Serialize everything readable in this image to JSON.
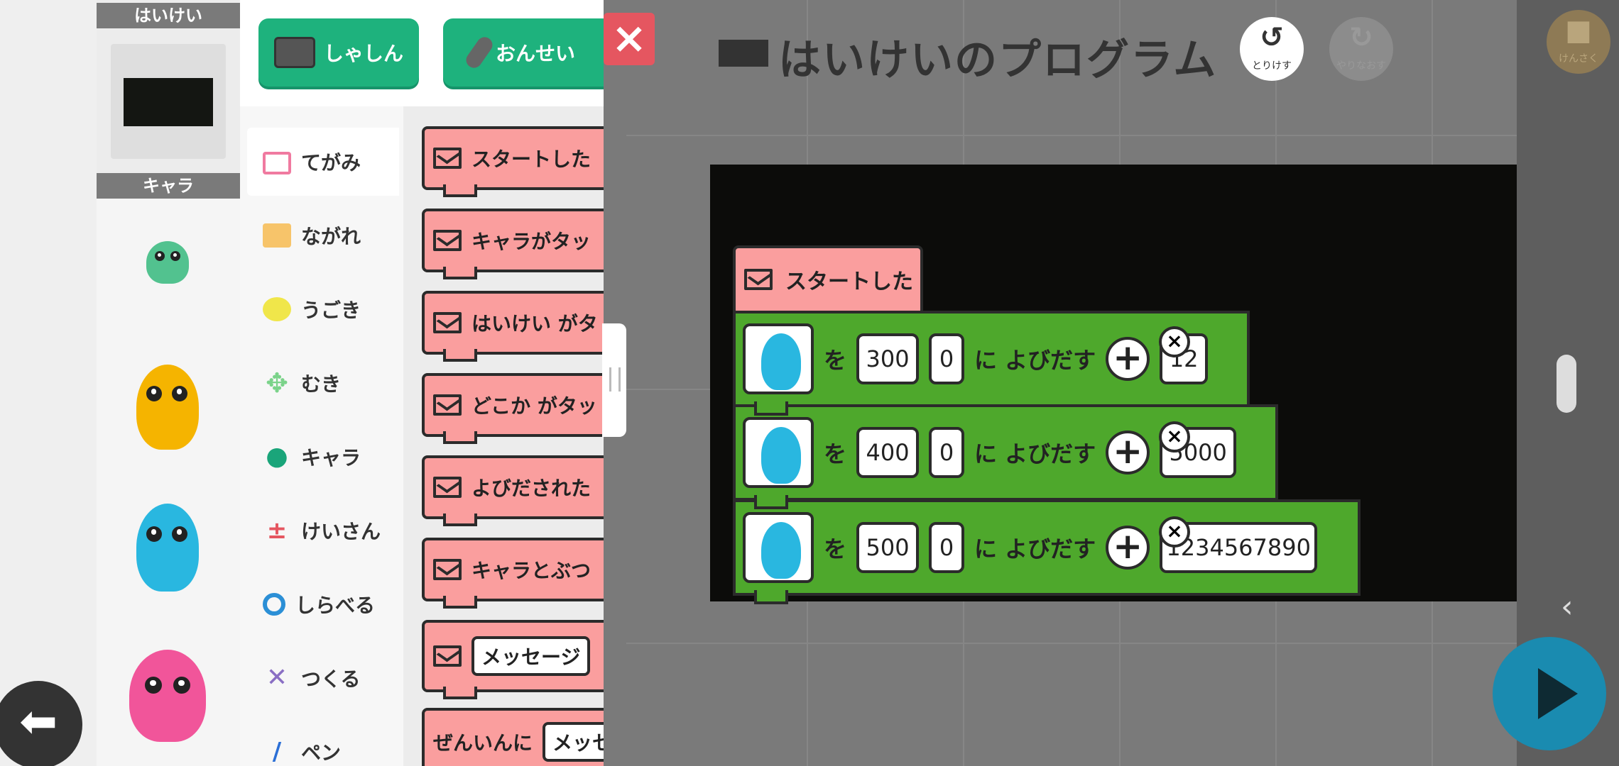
{
  "stage_panel": {
    "background_header": "はいけい",
    "character_header": "キャラ"
  },
  "top_buttons": {
    "photo_label": "しゃしん",
    "sound_label": "おんせい"
  },
  "categories": [
    {
      "label": "てがみ",
      "icon": "mail-icon"
    },
    {
      "label": "ながれ",
      "icon": "flow-icon"
    },
    {
      "label": "うごき",
      "icon": "motion-icon"
    },
    {
      "label": "むき",
      "icon": "direction-icon"
    },
    {
      "label": "キャラ",
      "icon": "character-icon"
    },
    {
      "label": "けいさん",
      "icon": "calculate-icon"
    },
    {
      "label": "しらべる",
      "icon": "search-icon"
    },
    {
      "label": "つくる",
      "icon": "tools-icon"
    },
    {
      "label": "ペン",
      "icon": "pen-icon"
    }
  ],
  "palette_blocks": [
    {
      "label": "スタートした"
    },
    {
      "label": "キャラがタッ"
    },
    {
      "label": "はいけい がタ"
    },
    {
      "label": "どこか がタッ"
    },
    {
      "label": "よびだされた"
    },
    {
      "label": "キャラとぶつ"
    },
    {
      "input": "メッセージ"
    },
    {
      "label": "ぜんいんに",
      "input": "メッセ"
    }
  ],
  "title": "はいけいのプログラム",
  "undo": {
    "label": "とりけす"
  },
  "redo": {
    "label": "やりなおす"
  },
  "camera": {
    "label": "けんさく"
  },
  "script": {
    "start_label": "スタートした",
    "rows": [
      {
        "wo": "を",
        "x": "300",
        "y": "0",
        "ni": "に よびだす",
        "extra": "12"
      },
      {
        "wo": "を",
        "x": "400",
        "y": "0",
        "ni": "に よびだす",
        "extra": "5000"
      },
      {
        "wo": "を",
        "x": "500",
        "y": "0",
        "ni": "に よびだす",
        "extra": "1234567890"
      }
    ]
  },
  "colors": {
    "green_button": "#1eb27d",
    "event_block": "#fa9e9e",
    "action_block": "#4ea82c",
    "close_button": "#e55660"
  }
}
